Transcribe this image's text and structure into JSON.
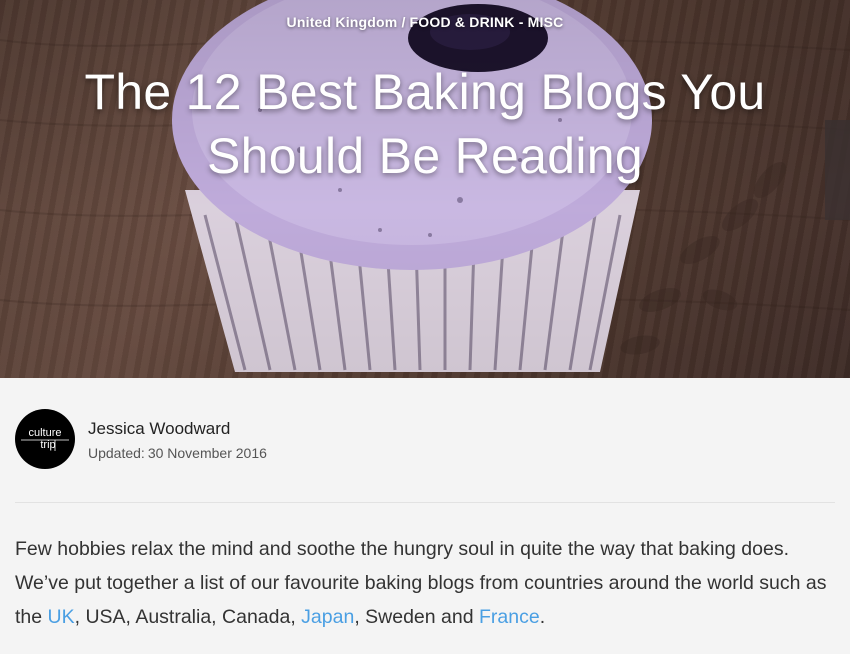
{
  "hero": {
    "category_location": "United Kingdom",
    "category_separator": "/",
    "category_section": "FOOD & DRINK - MISC",
    "title": "The 12 Best Baking Blogs You Should Be Reading"
  },
  "author": {
    "logo_text_line1": "culture",
    "logo_text_line2": "trip",
    "name": "Jessica Woodward",
    "updated_label": "Updated:",
    "updated_date": "30 November 2016"
  },
  "intro": {
    "text_1": "Few hobbies relax the mind and soothe the hungry soul in quite the way that baking does. We’ve put together a list of our favourite baking blogs from countries around the world such as the ",
    "link_uk": "UK",
    "text_2": ", USA, Australia, Canada, ",
    "link_japan": "Japan",
    "text_3": ", Sweden and ",
    "link_france": "France",
    "text_4": "."
  },
  "colors": {
    "link": "#4a9fe3",
    "body_text": "#333333",
    "background": "#f4f4f4",
    "frosting": "#c9b4e6"
  }
}
